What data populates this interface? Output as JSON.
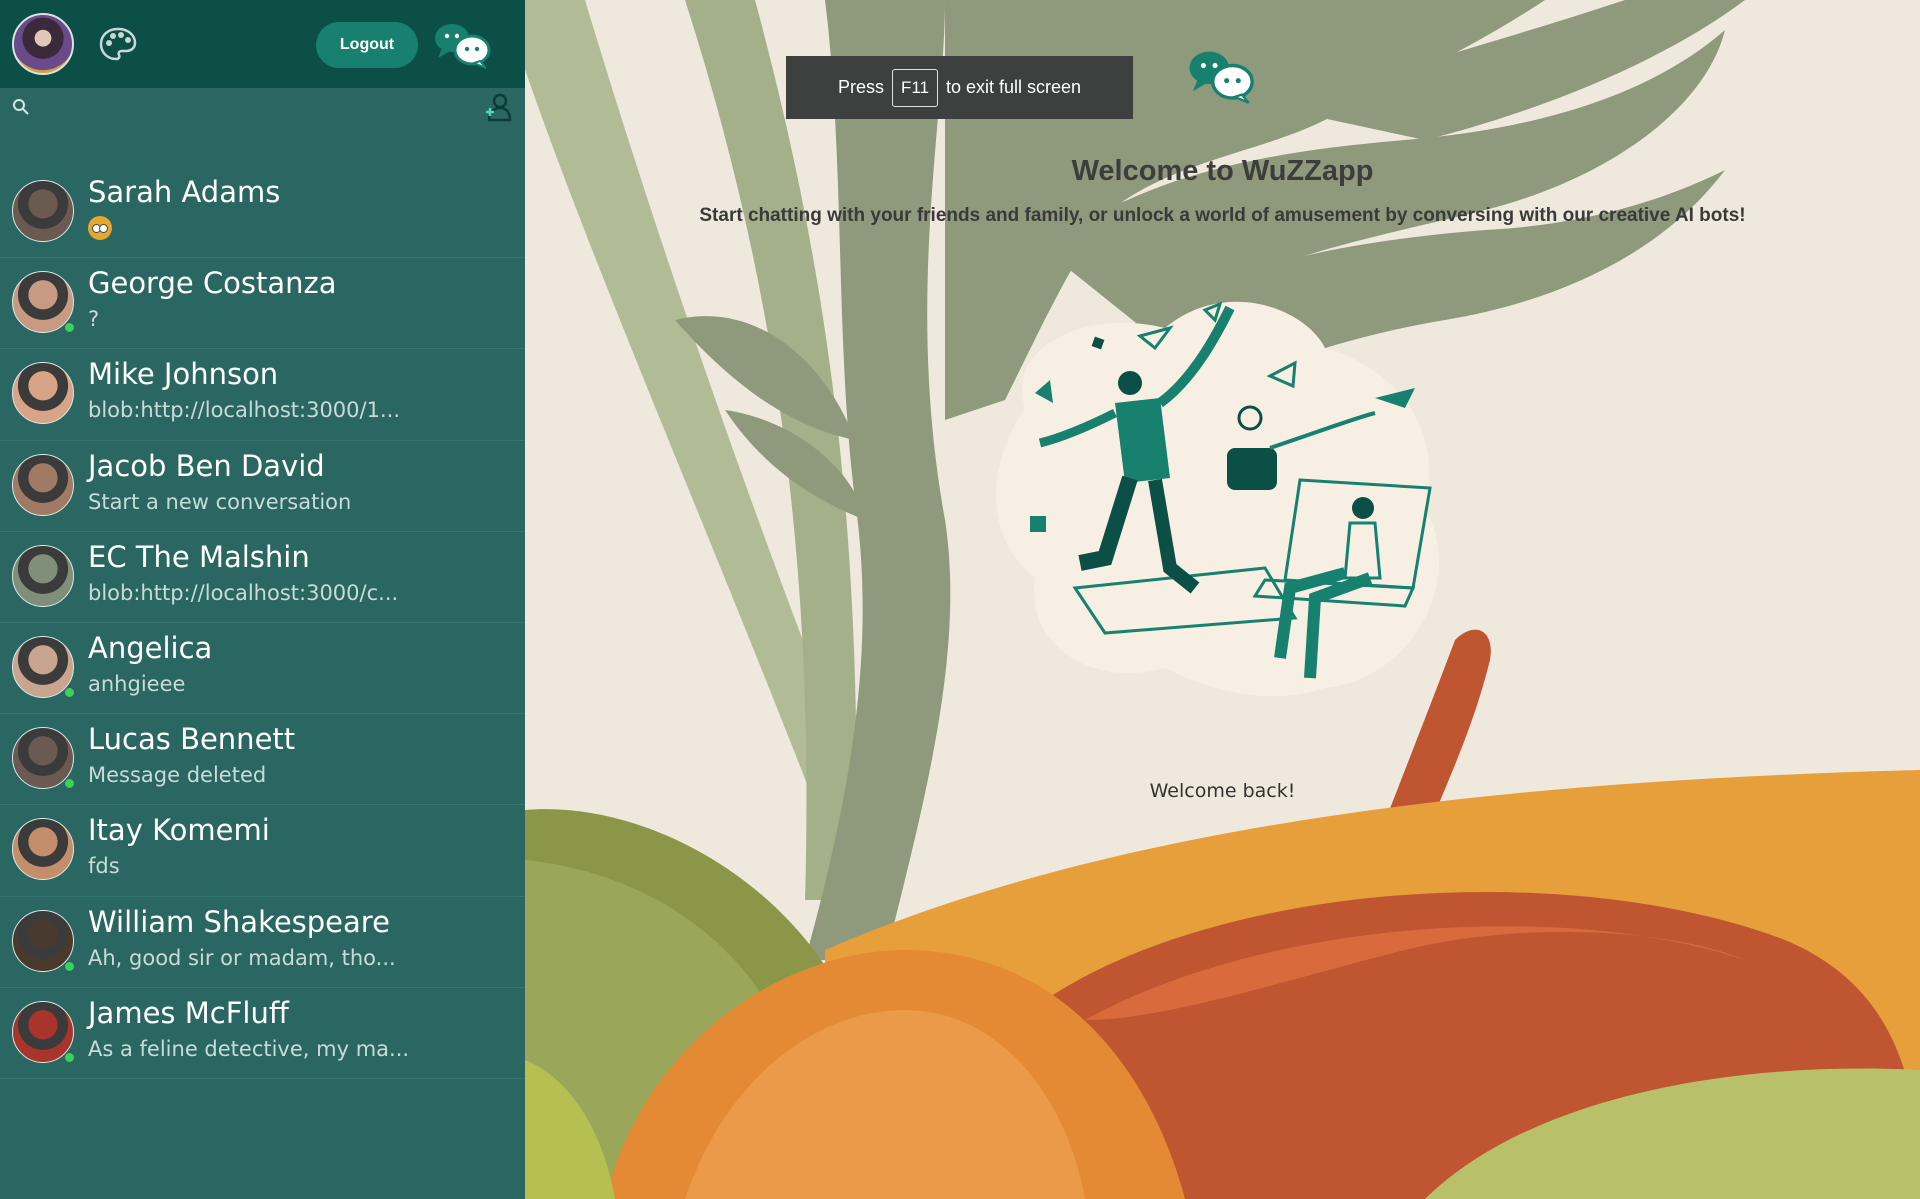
{
  "topbar": {
    "logout_label": "Logout"
  },
  "search": {
    "placeholder": ""
  },
  "chats": [
    {
      "name": "Sarah Adams",
      "preview": "",
      "preview_icon": "sticker-emoji",
      "online": false,
      "avatar_color": "#6b5a50"
    },
    {
      "name": "George Costanza",
      "preview": "?",
      "online": true,
      "avatar_color": "#c99a82"
    },
    {
      "name": "Mike Johnson",
      "preview": "blob:http://localhost:3000/1...",
      "online": false,
      "avatar_color": "#d7a488"
    },
    {
      "name": "Jacob Ben David",
      "preview": "Start a new conversation",
      "online": false,
      "avatar_color": "#a07a62"
    },
    {
      "name": "EC The Malshin",
      "preview": "blob:http://localhost:3000/c...",
      "online": false,
      "avatar_color": "#7f8f7a"
    },
    {
      "name": "Angelica",
      "preview": "anhgieee",
      "online": true,
      "avatar_color": "#c9a48f"
    },
    {
      "name": "Lucas Bennett",
      "preview": "Message deleted",
      "online": true,
      "avatar_color": "#6a5a52"
    },
    {
      "name": "Itay Komemi",
      "preview": "fds",
      "online": false,
      "avatar_color": "#c58e6a"
    },
    {
      "name": "William Shakespeare",
      "preview": "Ah, good sir or madam, tho...",
      "online": true,
      "avatar_color": "#4a3a2e"
    },
    {
      "name": "James McFluff",
      "preview": "As a feline detective, my ma...",
      "online": true,
      "avatar_color": "#a8342c"
    }
  ],
  "fullscreen_notice": {
    "press": "Press",
    "key": "F11",
    "rest": "to exit full screen"
  },
  "main": {
    "title": "Welcome to WuZZapp",
    "subtitle": "Start chatting with your friends and family, or unlock a world of amusement by conversing with our creative AI bots!",
    "welcome_back": "Welcome back!"
  },
  "colors": {
    "sidebar_bg": "#2b6762",
    "topbar_bg": "#0c4f47",
    "accent": "#17806f",
    "online": "#3cd25a"
  }
}
